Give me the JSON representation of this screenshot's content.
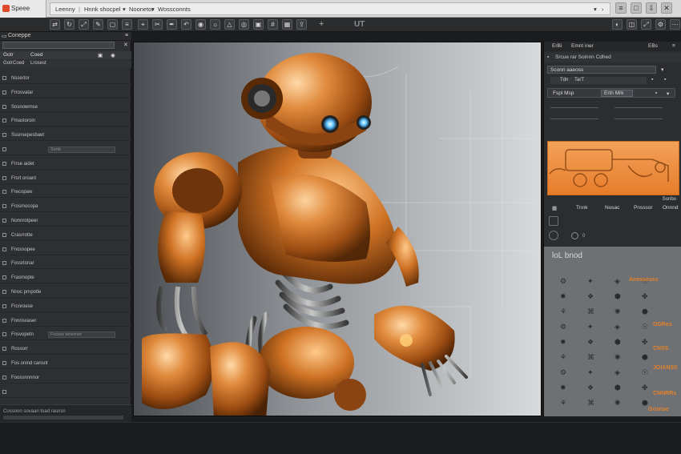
{
  "menubar": {
    "app_label": "Speee",
    "tabs": [
      "Leenny",
      "Hnnk shocpel",
      "Noonetor",
      "Wossconnts"
    ],
    "window_buttons": [
      "≡",
      "□",
      "⇩",
      "✕"
    ]
  },
  "toolstrip": {
    "zoom_text": "UT"
  },
  "left_panel": {
    "tabs": [
      "Coneppe"
    ],
    "header": [
      "Gotr",
      "Coed",
      "Lrosest"
    ],
    "rows": [
      {
        "label": "Nssertor",
        "field": ""
      },
      {
        "label": "Frrosvatar",
        "field": ""
      },
      {
        "label": "Sosnowrnse",
        "field": ""
      },
      {
        "label": "Fmastoroin",
        "field": ""
      },
      {
        "label": "Sssnsepesbaet",
        "field": ""
      },
      {
        "label": "",
        "field": "Sonb"
      },
      {
        "label": "Frrse aidet",
        "field": ""
      },
      {
        "label": "Frsrt oroant",
        "field": ""
      },
      {
        "label": "Frecopaw",
        "field": ""
      },
      {
        "label": "Frosmocopa",
        "field": ""
      },
      {
        "label": "Nonnrotpeer",
        "field": ""
      },
      {
        "label": "Crasrrotte",
        "field": ""
      },
      {
        "label": "Fnossopee",
        "field": ""
      },
      {
        "label": "Fossrtonar",
        "field": ""
      },
      {
        "label": "Frasmopte",
        "field": ""
      },
      {
        "label": "Nnoc prnpotle",
        "field": ""
      },
      {
        "label": "Frcnroese",
        "field": ""
      },
      {
        "label": "Fnnrisvaser",
        "field": ""
      },
      {
        "label": "Fnsvopetn",
        "field": "Frosoo tereoner"
      },
      {
        "label": "Rossorr",
        "field": ""
      },
      {
        "label": "Fos onind cansnt",
        "field": ""
      },
      {
        "label": "Foossnnnnor",
        "field": ""
      },
      {
        "label": "",
        "field": ""
      }
    ],
    "footer_text": "Cossoon sovaan toad rasnsn"
  },
  "right_panel": {
    "head": [
      "ErBi",
      "Emnt iner",
      "EBs"
    ],
    "row2": "Srcue rar Soinnn Cdhed",
    "section1": "Sconn aaeoss",
    "prop": [
      "Tdn",
      "TarT"
    ],
    "section2": "Fspl Msp",
    "section2_btn": "Ertn Mrk",
    "preview_caption": "Sonbo",
    "cols": [
      "Tnnk",
      "Nosac",
      "Pnsssor",
      "Onnnd"
    ],
    "grid": {
      "title": "loL bnod",
      "labels": [
        "Anesaesss",
        "OGRes",
        "CNSS",
        "JOIANSS",
        "CNNRRs",
        "Gosnse"
      ]
    }
  }
}
